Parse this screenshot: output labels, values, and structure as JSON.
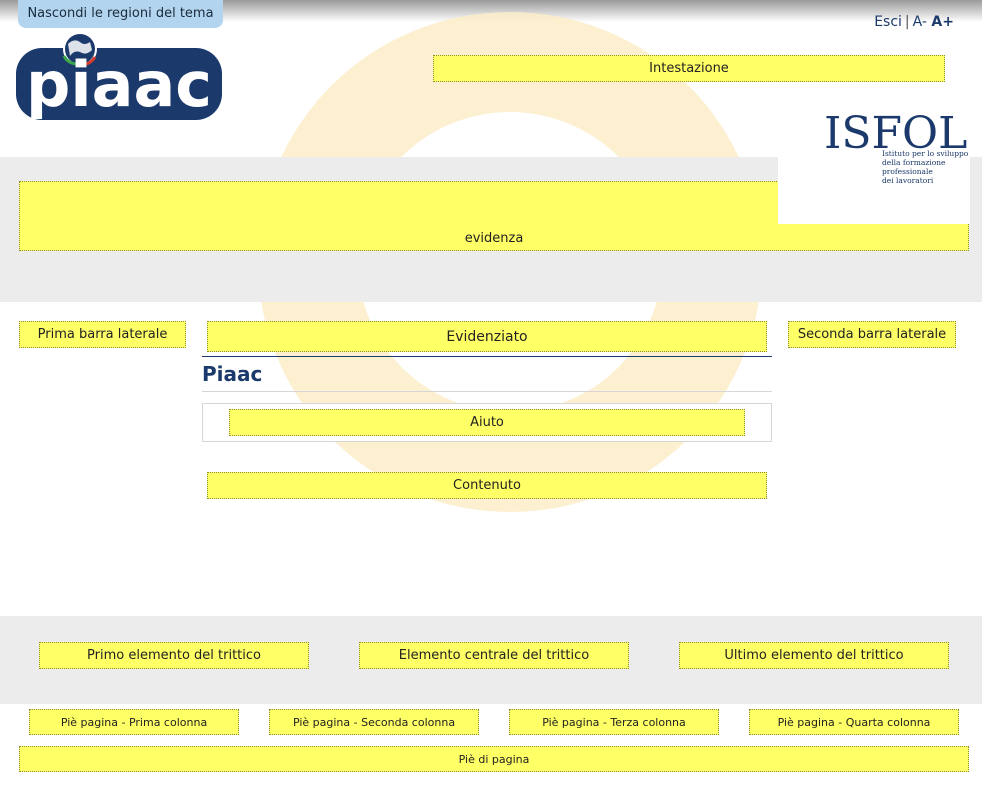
{
  "toggle": {
    "hide_regions": "Nascondi le regioni del tema"
  },
  "user_menu": {
    "logout": "Esci",
    "separator": "|",
    "font_smaller": "A-",
    "font_larger": "A+"
  },
  "brand": {
    "logo_text": "piaac",
    "logo_color": "#1b3a6b",
    "partner_name": "ISFOL",
    "partner_tagline": [
      "Istituto per lo sviluppo",
      "della formazione",
      "professionale",
      "dei lavoratori"
    ]
  },
  "regions": {
    "header": "Intestazione",
    "featured": "evidenza",
    "sidebar_first": "Prima barra laterale",
    "highlighted": "Evidenziato",
    "sidebar_second": "Seconda barra laterale",
    "help": "Aiuto",
    "content": "Contenuto",
    "triptych_first": "Primo elemento del trittico",
    "triptych_middle": "Elemento centrale del trittico",
    "triptych_last": "Ultimo elemento del trittico",
    "footer_first": "Piè pagina - Prima colonna",
    "footer_second": "Piè pagina - Seconda colonna",
    "footer_third": "Piè pagina - Terza colonna",
    "footer_fourth": "Piè pagina - Quarta colonna",
    "footer": "Piè di pagina"
  },
  "page": {
    "title": "Piaac"
  },
  "colors": {
    "region_fill": "#ffff66",
    "band_gray": "#ececec",
    "title_blue": "#1b3a6b",
    "toggle_blue": "#b3d4ee",
    "arch": "#fbedc9"
  }
}
